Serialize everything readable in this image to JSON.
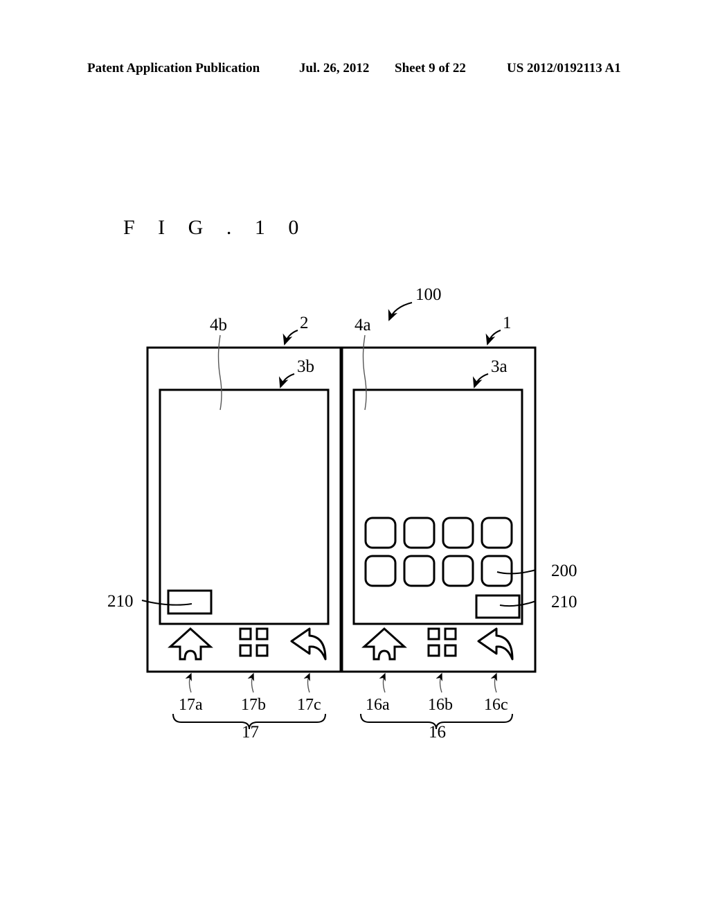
{
  "header": {
    "publication": "Patent Application Publication",
    "date": "Jul. 26, 2012",
    "sheet": "Sheet 9 of 22",
    "patent_number": "US 2012/0192113 A1"
  },
  "figure": {
    "title": "F I G .  1 0"
  },
  "labels": {
    "device": "100",
    "body_right": "1",
    "body_left": "2",
    "screen_right": "3a",
    "screen_left": "3b",
    "housing_right": "4a",
    "housing_left": "4b",
    "icon": "200",
    "box_right": "210",
    "box_left": "210",
    "buttons_left_group": "17",
    "buttons_left_home": "17a",
    "buttons_left_menu": "17b",
    "buttons_left_back": "17c",
    "buttons_right_group": "16",
    "buttons_right_home": "16a",
    "buttons_right_menu": "16b",
    "buttons_right_back": "16c"
  },
  "icons": {
    "home": "home-icon",
    "menu": "menu-grid-icon",
    "back": "back-arrow-icon"
  },
  "panels": {
    "left": {
      "name": "left-display-panel",
      "icon_grid_visible": false,
      "status_box_visible": true
    },
    "right": {
      "name": "right-display-panel",
      "icon_grid_visible": true,
      "icon_grid_rows": 2,
      "icon_grid_cols": 4,
      "status_box_visible": true
    }
  },
  "colors": {
    "line": "#000000",
    "background": "#ffffff",
    "thin_line": "#4a4a4a"
  }
}
